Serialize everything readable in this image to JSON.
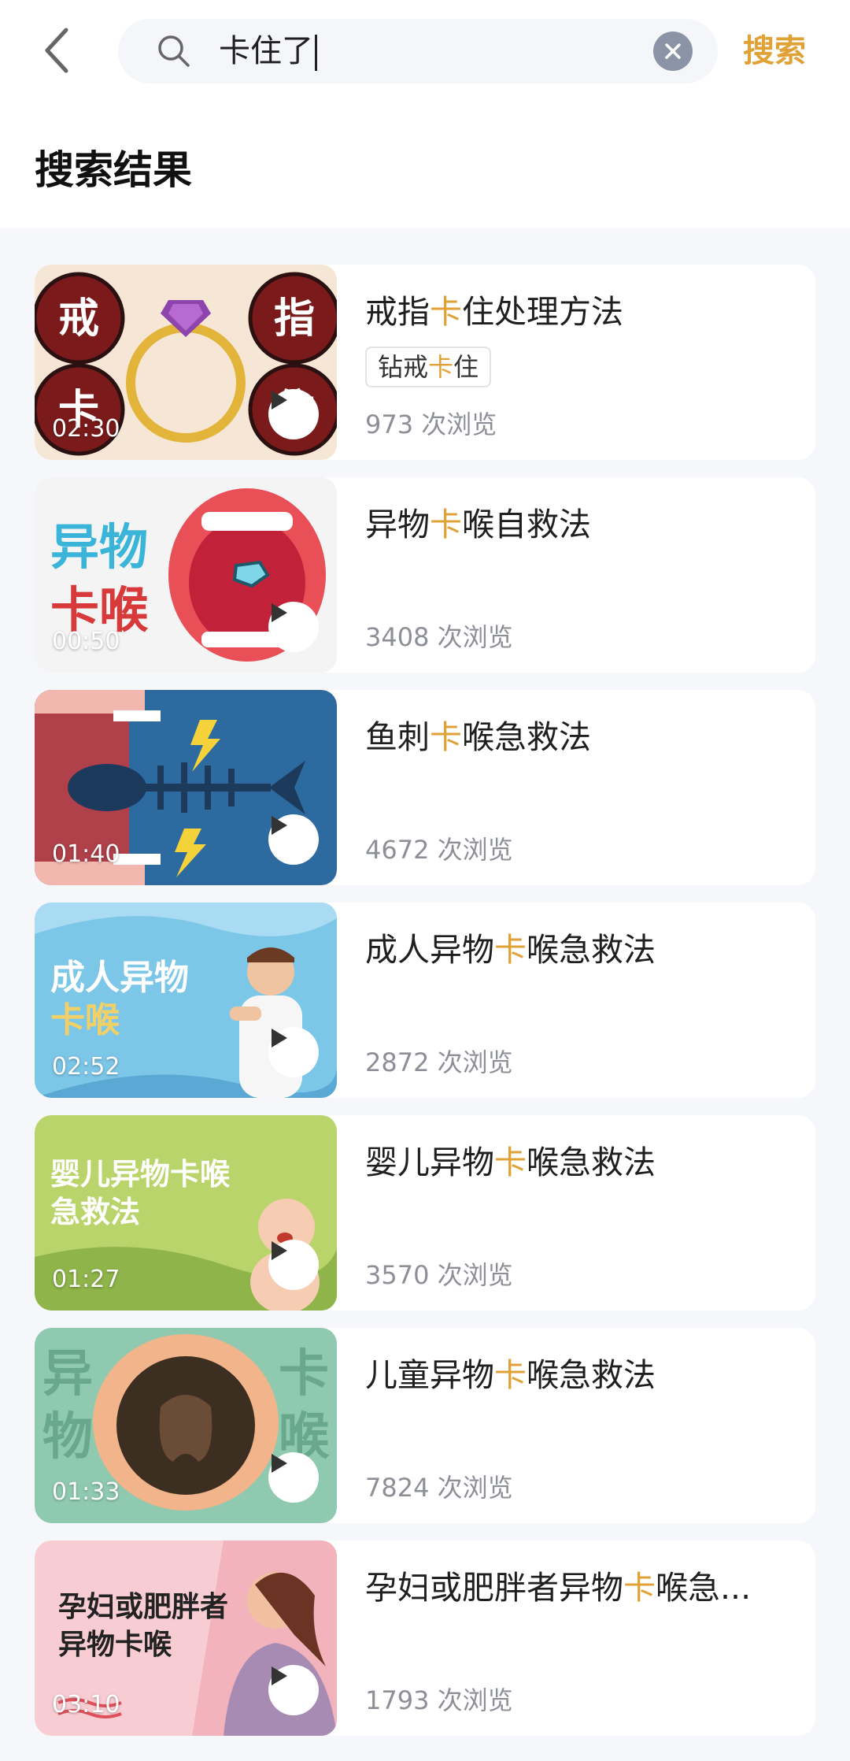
{
  "search": {
    "query": "卡住了",
    "submit_label": "搜索"
  },
  "section_title": "搜索结果",
  "highlight_color": "#e0a236",
  "videos": [
    {
      "title_pre": "戒指",
      "title_hl": "卡",
      "title_post": "住处理方法",
      "tag_pre": "钻戒",
      "tag_hl": "卡",
      "tag_post": "住",
      "duration": "02:30",
      "views": "973 次浏览",
      "thumb_text": [
        "戒",
        "指",
        "卡",
        "住"
      ]
    },
    {
      "title_pre": "异物",
      "title_hl": "卡",
      "title_post": "喉自救法",
      "duration": "00:50",
      "views": "3408 次浏览",
      "thumb_text": [
        "异物",
        "卡喉"
      ]
    },
    {
      "title_pre": "鱼刺",
      "title_hl": "卡",
      "title_post": "喉急救法",
      "duration": "01:40",
      "views": "4672 次浏览"
    },
    {
      "title_pre": "成人异物",
      "title_hl": "卡",
      "title_post": "喉急救法",
      "duration": "02:52",
      "views": "2872 次浏览",
      "thumb_text": [
        "成人异物",
        "卡喉"
      ]
    },
    {
      "title_pre": "婴儿异物",
      "title_hl": "卡",
      "title_post": "喉急救法",
      "duration": "01:27",
      "views": "3570 次浏览",
      "thumb_text": [
        "婴儿异物卡喉",
        "急救法"
      ]
    },
    {
      "title_pre": "儿童异物",
      "title_hl": "卡",
      "title_post": "喉急救法",
      "duration": "01:33",
      "views": "7824 次浏览",
      "thumb_text": [
        "异",
        "物",
        "卡",
        "喉"
      ]
    },
    {
      "title_pre": "孕妇或肥胖者异物",
      "title_hl": "卡",
      "title_post": "喉急...",
      "duration": "03:10",
      "views": "1793 次浏览",
      "thumb_text": [
        "孕妇或肥胖者",
        "异物卡喉"
      ]
    }
  ]
}
